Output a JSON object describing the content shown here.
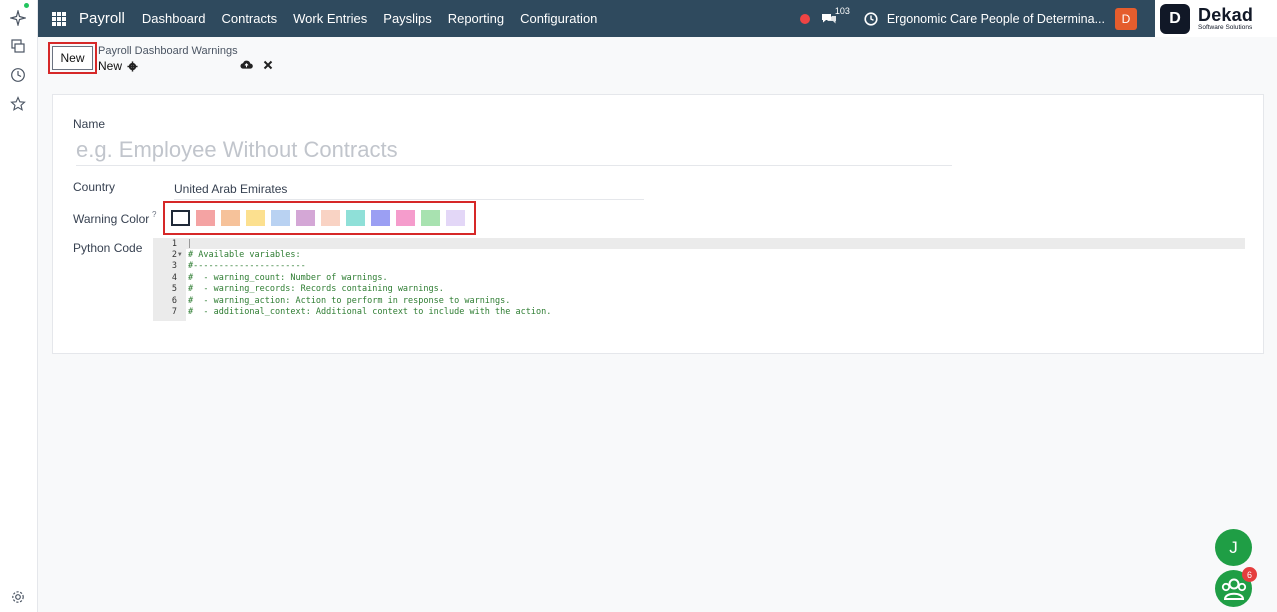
{
  "navbar": {
    "app_name": "Payroll",
    "menu": [
      "Dashboard",
      "Contracts",
      "Work Entries",
      "Payslips",
      "Reporting",
      "Configuration"
    ],
    "message_count": "103",
    "company": "Ergonomic Care People of Determina...",
    "user_initial": "D",
    "logo": {
      "mark": "D",
      "name": "Dekad",
      "subtitle": "Software Solutions"
    }
  },
  "control": {
    "new_label": "New",
    "breadcrumb_parent": "Payroll Dashboard Warnings",
    "breadcrumb_current": "New"
  },
  "form": {
    "name_label": "Name",
    "name_placeholder": "e.g. Employee Without Contracts",
    "country_label": "Country",
    "country_value": "United Arab Emirates",
    "warning_color_label": "Warning Color",
    "help_mark": "?",
    "colors": [
      "#ffffff",
      "#f4a3a3",
      "#f6c29a",
      "#fce08f",
      "#b9d2f2",
      "#d4a7d6",
      "#f9d3c4",
      "#8fe0d8",
      "#9b9ff3",
      "#f59ccc",
      "#a8e2b0",
      "#e3d7f7"
    ],
    "python_label": "Python Code",
    "code_lines": [
      {
        "num": "1",
        "text": ""
      },
      {
        "num": "2",
        "text": "# Available variables:"
      },
      {
        "num": "3",
        "text": "#----------------------"
      },
      {
        "num": "4",
        "text": "#  - warning_count: Number of warnings."
      },
      {
        "num": "5",
        "text": "#  - warning_records: Records containing warnings."
      },
      {
        "num": "6",
        "text": "#  - warning_action: Action to perform in response to warnings."
      },
      {
        "num": "7",
        "text": "#  - additional_context: Additional context to include with the action."
      }
    ]
  },
  "floating": {
    "chat_initial": "J",
    "bot_badge": "6"
  }
}
